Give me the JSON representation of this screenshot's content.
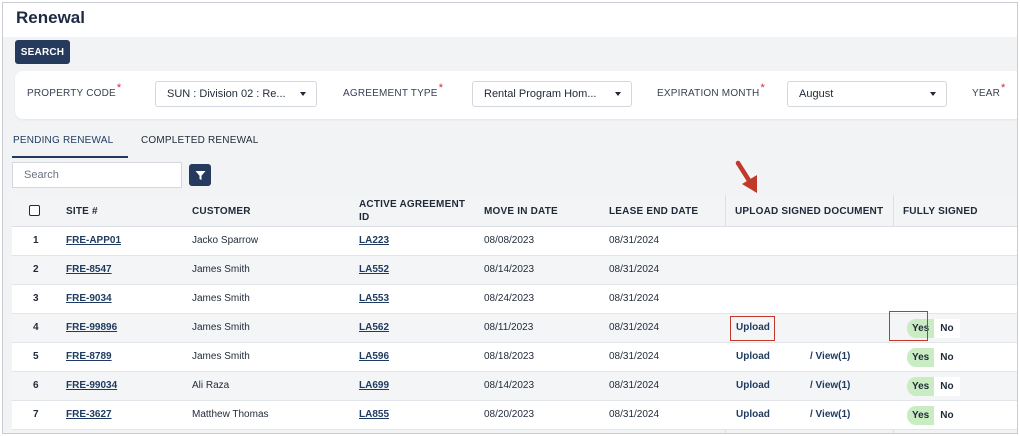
{
  "page": {
    "title": "Renewal"
  },
  "toolbar": {
    "search_label": "SEARCH"
  },
  "filters": {
    "property_code": {
      "label": "PROPERTY CODE",
      "value": "SUN : Division 02 : Re..."
    },
    "agreement_type": {
      "label": "AGREEMENT TYPE",
      "value": "Rental Program Hom..."
    },
    "expiration_month": {
      "label": "EXPIRATION MONTH",
      "value": "August"
    },
    "year": {
      "label": "YEAR"
    },
    "required_mark": "*"
  },
  "tabs": [
    {
      "label": "PENDING RENEWAL",
      "active": true
    },
    {
      "label": "COMPLETED RENEWAL",
      "active": false
    }
  ],
  "search": {
    "placeholder": "Search"
  },
  "table": {
    "columns": [
      "SITE #",
      "CUSTOMER",
      "ACTIVE AGREEMENT",
      "ID",
      "MOVE IN DATE",
      "LEASE END DATE",
      "UPLOAD SIGNED DOCUMENT",
      "FULLY SIGNED"
    ],
    "rows": [
      {
        "num": "1",
        "site": "FRE-APP01",
        "customer": "Jacko Sparrow",
        "agreement": "LA223",
        "move_in": "08/08/2023",
        "lease_end": "08/31/2024",
        "upload": "",
        "view": "",
        "yes": "",
        "no": ""
      },
      {
        "num": "2",
        "site": "FRE-8547",
        "customer": "James Smith",
        "agreement": "LA552",
        "move_in": "08/14/2023",
        "lease_end": "08/31/2024",
        "upload": "",
        "view": "",
        "yes": "",
        "no": ""
      },
      {
        "num": "3",
        "site": "FRE-9034",
        "customer": "James Smith",
        "agreement": "LA553",
        "move_in": "08/24/2023",
        "lease_end": "08/31/2024",
        "upload": "",
        "view": "",
        "yes": "",
        "no": ""
      },
      {
        "num": "4",
        "site": "FRE-99896",
        "customer": "James Smith",
        "agreement": "LA562",
        "move_in": "08/11/2023",
        "lease_end": "08/31/2024",
        "upload": "Upload",
        "view": "",
        "yes": "Yes",
        "no": "No"
      },
      {
        "num": "5",
        "site": "FRE-8789",
        "customer": "James Smith",
        "agreement": "LA596",
        "move_in": "08/18/2023",
        "lease_end": "08/31/2024",
        "upload": "Upload",
        "view": "/ View(1)",
        "yes": "Yes",
        "no": "No"
      },
      {
        "num": "6",
        "site": "FRE-99034",
        "customer": "Ali Raza",
        "agreement": "LA699",
        "move_in": "08/14/2023",
        "lease_end": "08/31/2024",
        "upload": "Upload",
        "view": "/ View(1)",
        "yes": "Yes",
        "no": "No"
      },
      {
        "num": "7",
        "site": "FRE-3627",
        "customer": "Matthew Thomas",
        "agreement": "LA855",
        "move_in": "08/20/2023",
        "lease_end": "08/31/2024",
        "upload": "Upload",
        "view": "/ View(1)",
        "yes": "Yes",
        "no": "No"
      }
    ]
  },
  "colors": {
    "accent": "#253a5c",
    "link": "#1e3a5f",
    "yes_bg": "#c9ecc2",
    "highlight": "#c0392b",
    "required": "#e11d48"
  }
}
